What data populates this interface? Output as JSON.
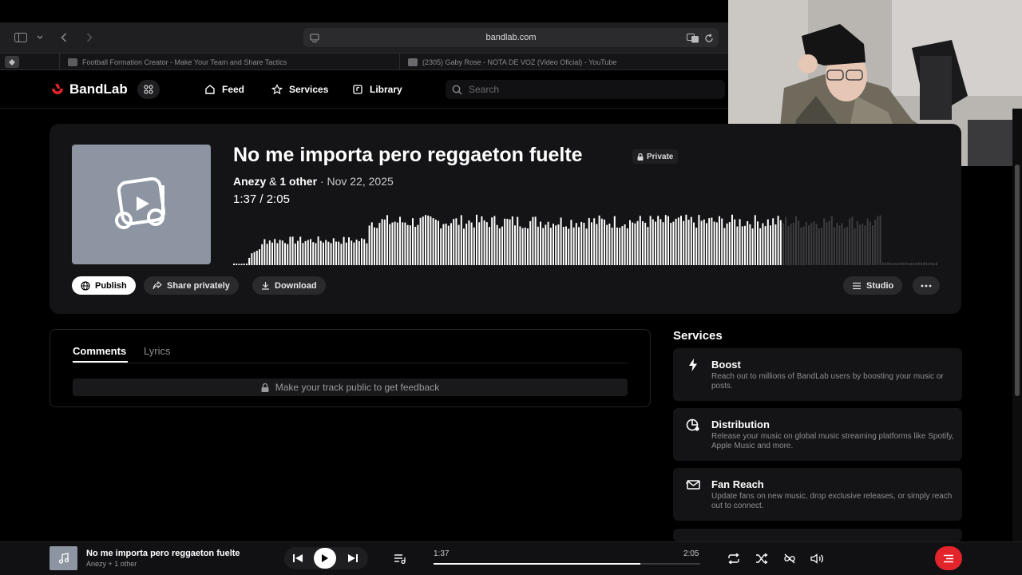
{
  "browser": {
    "address": "bandlab.com",
    "tabs": [
      {
        "title": "Football Formation Creator - Make Your Team and Share Tactics"
      },
      {
        "title": "(2305) Gaby Rose - NOTA DE VOZ (Video Oficial) - YouTube"
      }
    ]
  },
  "header": {
    "logo": "BandLab",
    "nav": [
      {
        "label": "Feed",
        "icon": "home-icon"
      },
      {
        "label": "Services",
        "icon": "star-icon"
      },
      {
        "label": "Library",
        "icon": "library-icon"
      }
    ],
    "search_placeholder": "Search"
  },
  "track": {
    "title": "No me importa pero reggaeton fuelte",
    "privacy": "Private",
    "artist": "Anezy",
    "others": "1 other",
    "date": "Nov 22, 2025",
    "current_time": "1:37",
    "total_time": "2:05",
    "progress": 0.776,
    "actions": {
      "publish": "Publish",
      "share": "Share privately",
      "download": "Download",
      "studio": "Studio"
    }
  },
  "comments": {
    "tabs": [
      "Comments",
      "Lyrics"
    ],
    "active_tab": "Comments",
    "feedback": "Make your track public to get feedback"
  },
  "services": {
    "heading": "Services",
    "items": [
      {
        "name": "Boost",
        "icon": "bolt-icon",
        "desc": "Reach out to millions of BandLab users by boosting your music or posts."
      },
      {
        "name": "Distribution",
        "icon": "distribution-icon",
        "desc": "Release your music on global music streaming platforms like Spotify, Apple Music and more."
      },
      {
        "name": "Fan Reach",
        "icon": "mail-icon",
        "desc": "Update fans on new music, drop exclusive releases, or simply reach out to connect."
      }
    ]
  },
  "player": {
    "title": "No me importa pero reggaeton fuelte",
    "artist": "Anezy + 1 other",
    "current_time": "1:37",
    "total_time": "2:05",
    "progress": 0.776
  },
  "colors": {
    "accent_red": "#e3242b",
    "cover": "#8c95a1",
    "card": "#141416"
  }
}
